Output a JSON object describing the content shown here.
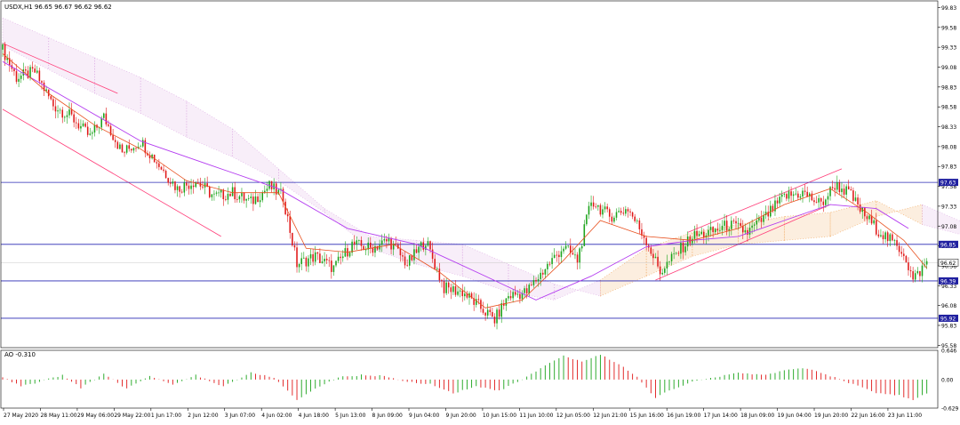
{
  "chart_data": {
    "type": "line",
    "title": "USDX,H1  96.65 96.67 96.62 96.62",
    "symbol": "USDX,H1",
    "ohlc": [
      "96.65",
      "96.67",
      "96.62",
      "96.62"
    ],
    "y_axis_ticks": [
      "99.83",
      "99.58",
      "99.33",
      "99.08",
      "98.83",
      "98.58",
      "98.33",
      "98.08",
      "97.83",
      "97.58",
      "97.33",
      "97.08",
      "96.83",
      "96.58",
      "96.33",
      "96.08",
      "95.83",
      "95.58"
    ],
    "ylim": [
      95.55,
      99.88
    ],
    "x_axis_labels": [
      "27 May 2020",
      "28 May 11:00",
      "29 May 06:00",
      "29 May 22:00",
      "1 Jun 17:00",
      "2 Jun 12:00",
      "3 Jun 07:00",
      "4 Jun 02:00",
      "4 Jun 18:00",
      "5 Jun 13:00",
      "8 Jun 09:00",
      "9 Jun 04:00",
      "9 Jun 20:00",
      "10 Jun 15:00",
      "11 Jun 10:00",
      "12 Jun 05:00",
      "12 Jun 21:00",
      "15 Jun 16:00",
      "16 Jun 19:00",
      "17 Jun 14:00",
      "18 Jun 09:00",
      "19 Jun 04:00",
      "19 Jun 20:00",
      "22 Jun 16:00",
      "23 Jun 11:00"
    ],
    "horizontal_levels": [
      {
        "label": "97.63",
        "value": 97.63
      },
      {
        "label": "96.85",
        "value": 96.85
      },
      {
        "label": "96.39",
        "value": 96.39
      },
      {
        "label": "95.92",
        "value": 95.92
      }
    ],
    "current_price": {
      "label": "96.62",
      "value": 96.62
    },
    "price_path": [
      {
        "i": 0,
        "v": 99.3
      },
      {
        "i": 6,
        "v": 98.95
      },
      {
        "i": 14,
        "v": 99.02
      },
      {
        "i": 22,
        "v": 98.6
      },
      {
        "i": 30,
        "v": 98.45
      },
      {
        "i": 38,
        "v": 98.2
      },
      {
        "i": 44,
        "v": 98.45
      },
      {
        "i": 52,
        "v": 98.0
      },
      {
        "i": 60,
        "v": 98.15
      },
      {
        "i": 68,
        "v": 97.85
      },
      {
        "i": 76,
        "v": 97.55
      },
      {
        "i": 84,
        "v": 97.65
      },
      {
        "i": 92,
        "v": 97.45
      },
      {
        "i": 100,
        "v": 97.5
      },
      {
        "i": 108,
        "v": 97.38
      },
      {
        "i": 116,
        "v": 97.58
      },
      {
        "i": 122,
        "v": 97.45
      },
      {
        "i": 128,
        "v": 96.6
      },
      {
        "i": 136,
        "v": 96.7
      },
      {
        "i": 144,
        "v": 96.55
      },
      {
        "i": 152,
        "v": 96.85
      },
      {
        "i": 160,
        "v": 96.8
      },
      {
        "i": 168,
        "v": 96.9
      },
      {
        "i": 176,
        "v": 96.6
      },
      {
        "i": 184,
        "v": 96.9
      },
      {
        "i": 192,
        "v": 96.3
      },
      {
        "i": 200,
        "v": 96.25
      },
      {
        "i": 208,
        "v": 96.05
      },
      {
        "i": 214,
        "v": 95.9
      },
      {
        "i": 220,
        "v": 96.2
      },
      {
        "i": 228,
        "v": 96.25
      },
      {
        "i": 236,
        "v": 96.55
      },
      {
        "i": 244,
        "v": 96.82
      },
      {
        "i": 250,
        "v": 96.65
      },
      {
        "i": 256,
        "v": 97.4
      },
      {
        "i": 264,
        "v": 97.2
      },
      {
        "i": 272,
        "v": 97.3
      },
      {
        "i": 280,
        "v": 96.9
      },
      {
        "i": 286,
        "v": 96.5
      },
      {
        "i": 292,
        "v": 96.7
      },
      {
        "i": 300,
        "v": 96.95
      },
      {
        "i": 308,
        "v": 97.0
      },
      {
        "i": 316,
        "v": 97.1
      },
      {
        "i": 324,
        "v": 97.0
      },
      {
        "i": 332,
        "v": 97.2
      },
      {
        "i": 340,
        "v": 97.45
      },
      {
        "i": 348,
        "v": 97.5
      },
      {
        "i": 356,
        "v": 97.35
      },
      {
        "i": 362,
        "v": 97.6
      },
      {
        "i": 368,
        "v": 97.5
      },
      {
        "i": 374,
        "v": 97.25
      },
      {
        "i": 380,
        "v": 97.05
      },
      {
        "i": 386,
        "v": 96.9
      },
      {
        "i": 392,
        "v": 96.75
      },
      {
        "i": 396,
        "v": 96.4
      },
      {
        "i": 402,
        "v": 96.62
      }
    ],
    "ema_fast": [
      {
        "i": 0,
        "v": 99.25
      },
      {
        "i": 20,
        "v": 98.75
      },
      {
        "i": 40,
        "v": 98.35
      },
      {
        "i": 60,
        "v": 98.05
      },
      {
        "i": 80,
        "v": 97.65
      },
      {
        "i": 100,
        "v": 97.5
      },
      {
        "i": 120,
        "v": 97.5
      },
      {
        "i": 132,
        "v": 96.8
      },
      {
        "i": 150,
        "v": 96.75
      },
      {
        "i": 170,
        "v": 96.85
      },
      {
        "i": 190,
        "v": 96.5
      },
      {
        "i": 210,
        "v": 96.05
      },
      {
        "i": 226,
        "v": 96.15
      },
      {
        "i": 244,
        "v": 96.65
      },
      {
        "i": 260,
        "v": 97.15
      },
      {
        "i": 280,
        "v": 96.95
      },
      {
        "i": 300,
        "v": 96.9
      },
      {
        "i": 320,
        "v": 97.05
      },
      {
        "i": 340,
        "v": 97.35
      },
      {
        "i": 360,
        "v": 97.55
      },
      {
        "i": 376,
        "v": 97.25
      },
      {
        "i": 392,
        "v": 96.9
      },
      {
        "i": 402,
        "v": 96.55
      }
    ],
    "sma_slow": [
      {
        "i": 0,
        "v": 99.15
      },
      {
        "i": 30,
        "v": 98.65
      },
      {
        "i": 60,
        "v": 98.15
      },
      {
        "i": 90,
        "v": 97.85
      },
      {
        "i": 120,
        "v": 97.55
      },
      {
        "i": 150,
        "v": 97.05
      },
      {
        "i": 180,
        "v": 96.85
      },
      {
        "i": 210,
        "v": 96.45
      },
      {
        "i": 232,
        "v": 96.15
      },
      {
        "i": 256,
        "v": 96.45
      },
      {
        "i": 280,
        "v": 96.82
      },
      {
        "i": 300,
        "v": 96.9
      },
      {
        "i": 320,
        "v": 96.95
      },
      {
        "i": 340,
        "v": 97.15
      },
      {
        "i": 360,
        "v": 97.35
      },
      {
        "i": 380,
        "v": 97.3
      },
      {
        "i": 394,
        "v": 97.05
      }
    ],
    "channels": [
      {
        "name": "down-upper",
        "points": [
          {
            "i": 0,
            "v": 99.38
          },
          {
            "i": 50,
            "v": 98.75
          }
        ]
      },
      {
        "name": "down-lower",
        "points": [
          {
            "i": 0,
            "v": 98.55
          },
          {
            "i": 95,
            "v": 96.95
          }
        ]
      },
      {
        "name": "up-upper",
        "points": [
          {
            "i": 298,
            "v": 97.0
          },
          {
            "i": 365,
            "v": 97.8
          }
        ]
      },
      {
        "name": "up-lower",
        "points": [
          {
            "i": 284,
            "v": 96.4
          },
          {
            "i": 360,
            "v": 97.35
          }
        ]
      }
    ],
    "cloud": [
      {
        "i": 0,
        "a": 99.7,
        "b": 99.35
      },
      {
        "i": 20,
        "a": 99.45,
        "b": 99.05
      },
      {
        "i": 40,
        "a": 99.2,
        "b": 98.75
      },
      {
        "i": 60,
        "a": 98.95,
        "b": 98.5
      },
      {
        "i": 80,
        "a": 98.65,
        "b": 98.2
      },
      {
        "i": 100,
        "a": 98.3,
        "b": 97.95
      },
      {
        "i": 120,
        "a": 97.8,
        "b": 97.65
      },
      {
        "i": 140,
        "a": 97.3,
        "b": 97.25
      },
      {
        "i": 160,
        "a": 96.95,
        "b": 96.8
      },
      {
        "i": 180,
        "a": 96.9,
        "b": 96.6
      },
      {
        "i": 200,
        "a": 96.85,
        "b": 96.45
      },
      {
        "i": 220,
        "a": 96.6,
        "b": 96.25
      },
      {
        "i": 240,
        "a": 96.35,
        "b": 96.15
      },
      {
        "i": 260,
        "a": 96.2,
        "b": 96.4
      },
      {
        "i": 280,
        "a": 96.45,
        "b": 96.8
      },
      {
        "i": 300,
        "a": 96.7,
        "b": 97.0
      },
      {
        "i": 320,
        "a": 96.85,
        "b": 97.1
      },
      {
        "i": 340,
        "a": 96.9,
        "b": 97.2
      },
      {
        "i": 360,
        "a": 96.95,
        "b": 97.25
      },
      {
        "i": 380,
        "a": 97.2,
        "b": 97.4
      },
      {
        "i": 400,
        "a": 97.35,
        "b": 97.1
      },
      {
        "i": 420,
        "a": 97.1,
        "b": 96.95
      },
      {
        "i": 440,
        "a": 96.85,
        "b": 96.75
      }
    ],
    "oscillator": {
      "name": "AO -0.310",
      "ticks": [
        "0.646",
        "0.00",
        "-0.629"
      ],
      "ylim": [
        -0.629,
        0.646
      ],
      "path": [
        {
          "i": 0,
          "v": 0.05
        },
        {
          "i": 8,
          "v": -0.15
        },
        {
          "i": 16,
          "v": -0.05
        },
        {
          "i": 26,
          "v": 0.1
        },
        {
          "i": 34,
          "v": -0.18
        },
        {
          "i": 44,
          "v": 0.12
        },
        {
          "i": 54,
          "v": -0.2
        },
        {
          "i": 64,
          "v": 0.08
        },
        {
          "i": 74,
          "v": -0.12
        },
        {
          "i": 84,
          "v": 0.1
        },
        {
          "i": 96,
          "v": -0.15
        },
        {
          "i": 108,
          "v": 0.15
        },
        {
          "i": 118,
          "v": 0.05
        },
        {
          "i": 128,
          "v": -0.45
        },
        {
          "i": 136,
          "v": -0.2
        },
        {
          "i": 146,
          "v": 0.05
        },
        {
          "i": 156,
          "v": 0.1
        },
        {
          "i": 166,
          "v": 0.08
        },
        {
          "i": 176,
          "v": -0.05
        },
        {
          "i": 186,
          "v": -0.1
        },
        {
          "i": 196,
          "v": -0.3
        },
        {
          "i": 206,
          "v": -0.15
        },
        {
          "i": 216,
          "v": -0.25
        },
        {
          "i": 226,
          "v": 0.0
        },
        {
          "i": 236,
          "v": 0.3
        },
        {
          "i": 244,
          "v": 0.52
        },
        {
          "i": 252,
          "v": 0.4
        },
        {
          "i": 260,
          "v": 0.55
        },
        {
          "i": 268,
          "v": 0.35
        },
        {
          "i": 276,
          "v": 0.05
        },
        {
          "i": 284,
          "v": -0.4
        },
        {
          "i": 292,
          "v": -0.2
        },
        {
          "i": 300,
          "v": -0.05
        },
        {
          "i": 310,
          "v": 0.05
        },
        {
          "i": 320,
          "v": 0.15
        },
        {
          "i": 330,
          "v": 0.1
        },
        {
          "i": 340,
          "v": 0.2
        },
        {
          "i": 350,
          "v": 0.25
        },
        {
          "i": 360,
          "v": 0.08
        },
        {
          "i": 370,
          "v": -0.1
        },
        {
          "i": 380,
          "v": -0.3
        },
        {
          "i": 390,
          "v": -0.35
        },
        {
          "i": 396,
          "v": -0.45
        },
        {
          "i": 402,
          "v": -0.31
        }
      ]
    },
    "colors": {
      "bull": "#1aa31a",
      "bear": "#e01818",
      "ema": "#e8501e",
      "sma": "#b43cf0",
      "channel": "#ff3c78",
      "level": "#2828b4",
      "level_label_bg": "#2020a0",
      "price_label_bg": "#ffffff",
      "cloud": "#f0a050",
      "cloud_alt": "#d8a0e0",
      "grid": "#cccccc",
      "text": "#000000"
    }
  }
}
